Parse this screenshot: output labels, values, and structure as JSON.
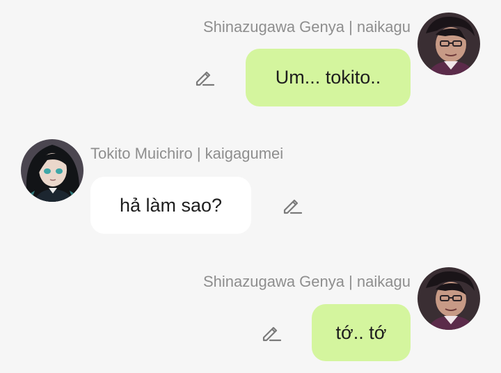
{
  "messages": [
    {
      "side": "right",
      "sender": "Shinazugawa Genya | naikagu",
      "text": "Um... tokito..",
      "avatar_icon": "genya-avatar"
    },
    {
      "side": "left",
      "sender": "Tokito Muichiro | kaigagumei",
      "text": "hả làm sao?",
      "avatar_icon": "muichiro-avatar"
    },
    {
      "side": "right",
      "sender": "Shinazugawa Genya | naikagu",
      "text": "tớ.. tớ",
      "avatar_icon": "genya-avatar"
    }
  ],
  "colors": {
    "background": "#f6f6f6",
    "mine_bubble": "#d4f59e",
    "their_bubble": "#ffffff",
    "sender_text": "#8e8e8e",
    "message_text": "#1e1e1e"
  },
  "icons": {
    "edit": "pencil-edit-icon"
  }
}
